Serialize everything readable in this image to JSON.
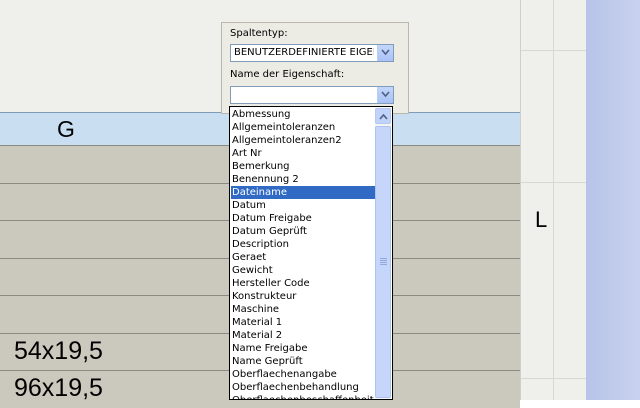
{
  "sheet": {
    "column_g": "G",
    "column_l": "L",
    "row_values": [
      "",
      "",
      "",
      "",
      "",
      "54x19,5",
      "96x19,5"
    ]
  },
  "panel": {
    "column_type_label": "Spaltentyp:",
    "column_type_value": "BENUTZERDEFINIERTE EIGEN",
    "property_label": "Name der Eigenschaft:",
    "property_value": ""
  },
  "dropdown": {
    "selected": "Dateiname",
    "items": [
      "Abmessung",
      "Allgemeintoleranzen",
      "Allgemeintoleranzen2",
      "Art Nr",
      "Bemerkung",
      "Benennung 2",
      "Dateiname",
      "Datum",
      "Datum Freigabe",
      "Datum Geprüft",
      "Description",
      "Geraet",
      "Gewicht",
      "Hersteller Code",
      "Konstrukteur",
      "Maschine",
      "Material 1",
      "Material 2",
      "Name Freigabe",
      "Name Geprüft",
      "Oberflaechenangabe",
      "Oberflaechenbehandlung",
      "Oberflaechenbeschaffenheit"
    ]
  },
  "colors": {
    "selection": "#316ac5",
    "header_row": "#c9dff1",
    "data_row": "#cbc8bd"
  }
}
